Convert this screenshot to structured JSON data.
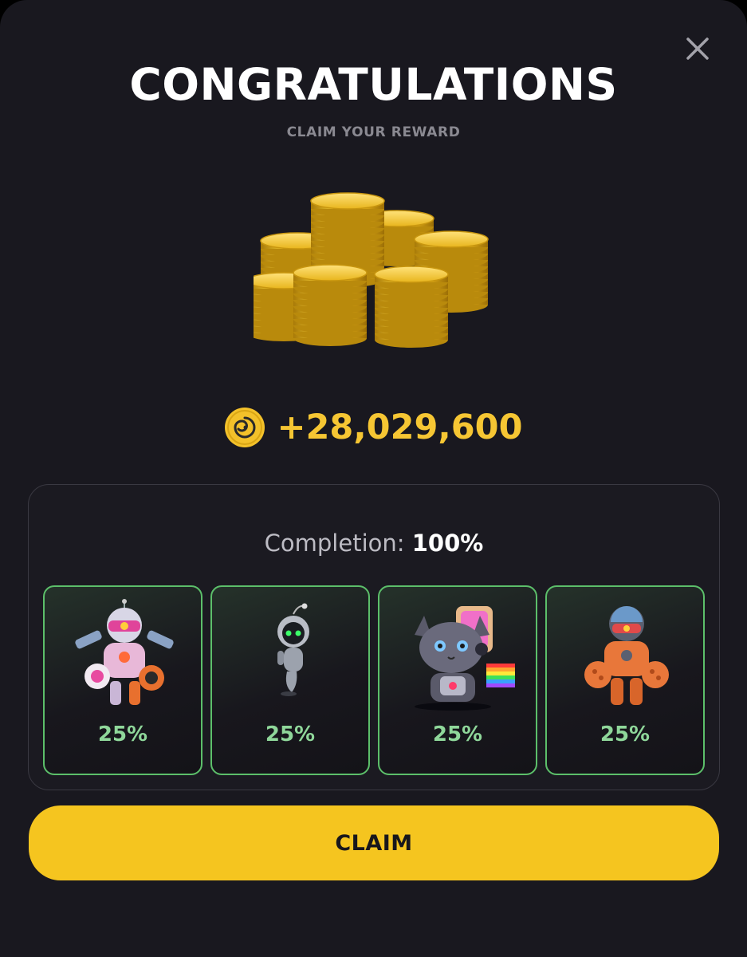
{
  "modal": {
    "title": "CONGRATULATIONS",
    "subtitle": "CLAIM YOUR REWARD",
    "close_icon": "close-icon"
  },
  "reward": {
    "icon": "coin-swirl-icon",
    "amount": "+28,029,600",
    "amount_color": "#f6c633"
  },
  "completion": {
    "label": "Completion:",
    "value": "100%"
  },
  "cards": [
    {
      "art": "pink-mech-robot-icon",
      "percent": "25%"
    },
    {
      "art": "small-floating-robot-icon",
      "percent": "25%"
    },
    {
      "art": "cyber-cat-icon",
      "percent": "25%"
    },
    {
      "art": "orange-mech-robot-icon",
      "percent": "25%"
    }
  ],
  "claim_button": {
    "label": "CLAIM",
    "color": "#f5c51f"
  },
  "colors": {
    "background": "#19181f",
    "card_border": "#5cbf6a",
    "card_percent": "#8fd79a"
  }
}
